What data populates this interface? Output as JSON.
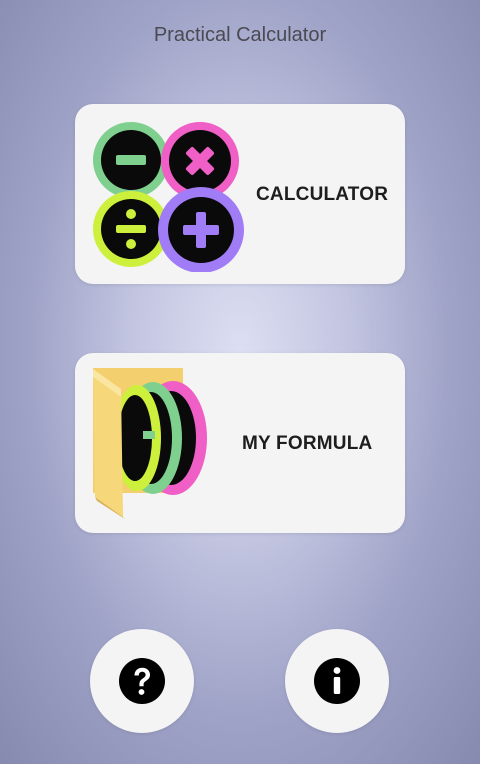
{
  "app": {
    "title": "Practical Calculator"
  },
  "menu": {
    "calculator_label": "CALCULATOR",
    "formula_label": "MY FORMULA"
  },
  "icons": {
    "calculator": "math-operators-icon",
    "formula": "formula-folder-icon",
    "help": "question-mark-icon",
    "info": "info-icon"
  },
  "colors": {
    "minus_ring": "#7fcf8f",
    "times_ring": "#ef5fc6",
    "divide_ring": "#cdf03c",
    "plus_ring": "#a07cf6",
    "card_bg": "#f4f4f4",
    "folder": "#f6d77a"
  }
}
